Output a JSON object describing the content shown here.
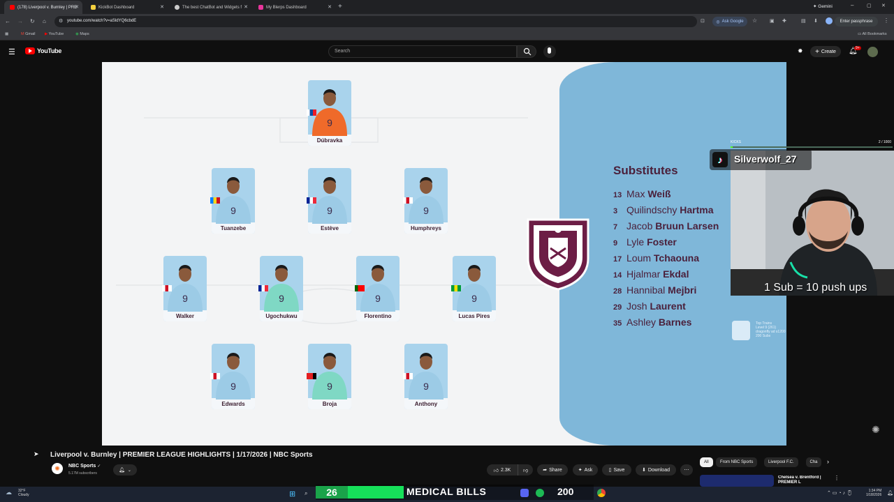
{
  "browser": {
    "tabs": [
      {
        "title": "(178) Liverpool v. Burnley | PRE",
        "active": true
      },
      {
        "title": "KickBot Dashboard",
        "active": false
      },
      {
        "title": "The best ChatBot and Widgets f",
        "active": false
      },
      {
        "title": "My Blerps Dashboard",
        "active": false
      }
    ],
    "gemini_label": "Gemini",
    "url": "youtube.com/watch?v=aSldYQ6cbdE",
    "ask_google": "Ask Google",
    "passphrase": "Enter passphrase",
    "bookmarks": [
      "Gmail",
      "YouTube",
      "Maps"
    ],
    "all_bookmarks": "All Bookmarks"
  },
  "youtube": {
    "logo": "YouTube",
    "search_placeholder": "Search",
    "create_label": "Create",
    "notif_count": "9+"
  },
  "video": {
    "lineup": [
      {
        "name": "Dúbravka"
      },
      {
        "name": "Tuanzebe"
      },
      {
        "name": "Estève"
      },
      {
        "name": "Humphreys"
      },
      {
        "name": "Walker"
      },
      {
        "name": "Ugochukwu"
      },
      {
        "name": "Florentino"
      },
      {
        "name": "Lucas Pires"
      },
      {
        "name": "Edwards"
      },
      {
        "name": "Broja"
      },
      {
        "name": "Anthony"
      }
    ],
    "subs_title": "Substitutes",
    "subs": [
      {
        "num": "13",
        "first": "Max",
        "last": "Weiß"
      },
      {
        "num": "3",
        "first": "Quilindschy",
        "last": "Hartma"
      },
      {
        "num": "7",
        "first": "Jacob",
        "last": "Bruun Larsen"
      },
      {
        "num": "9",
        "first": "Lyle",
        "last": "Foster"
      },
      {
        "num": "17",
        "first": "Loum",
        "last": "Tchaouna"
      },
      {
        "num": "14",
        "first": "Hjalmar",
        "last": "Ekdal"
      },
      {
        "num": "28",
        "first": "Hannibal",
        "last": "Mejbri"
      },
      {
        "num": "29",
        "first": "Josh",
        "last": "Laurent"
      },
      {
        "num": "35",
        "first": "Ashley",
        "last": "Barnes"
      }
    ],
    "crest_text": "BURNLEY FOOTBALL CLUB"
  },
  "stream_overlay": {
    "kicks_label": "KICKS",
    "kicks_count": "2 / 1000",
    "tiktok_user": "Silverwolf_27",
    "pushups_text": "1 Sub = 10 push ups",
    "train_lines": [
      "Top Trains",
      "Level 9 (261)",
      "dragonfly ad s1200",
      "200 Subs"
    ]
  },
  "below_video": {
    "title": "Liverpool v. Burnley | PREMIER LEAGUE HIGHLIGHTS | 1/17/2026 | NBC Sports",
    "channel": "NBC Sports",
    "subscribers": "5.17M subscribers",
    "likes": "2.3K",
    "share": "Share",
    "ask": "Ask",
    "save": "Save",
    "download": "Download",
    "chips": [
      "All",
      "From NBC Sports",
      "Liverpool F.C.",
      "Cha"
    ],
    "rec_title": "Chelsea v. Brentford | PREMIER L"
  },
  "taskbar": {
    "weather_temp": "32°F",
    "weather_desc": "Cloudy",
    "counter_left": "26",
    "banner": "MEDICAL BILLS",
    "counter_right": "200",
    "time": "1:34 PM",
    "date": "1/18/2026"
  }
}
